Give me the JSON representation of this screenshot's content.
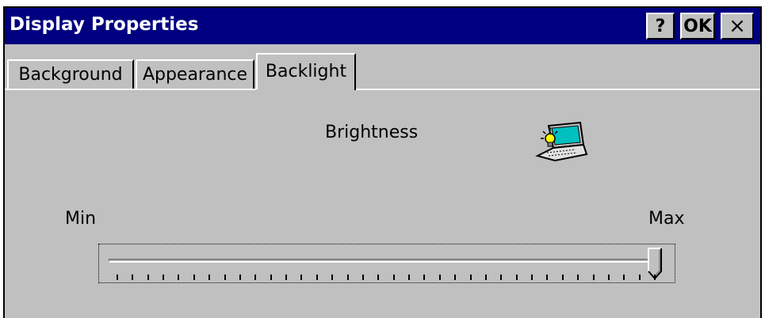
{
  "window": {
    "title": "Display Properties",
    "help_label": "?",
    "ok_label": "OK",
    "close_label": "×"
  },
  "tabs": [
    {
      "label": "Background",
      "active": false
    },
    {
      "label": "Appearance",
      "active": false
    },
    {
      "label": "Backlight",
      "active": true
    }
  ],
  "backlight": {
    "heading": "Brightness",
    "icon": "laptop-backlight-icon",
    "slider": {
      "min_label": "Min",
      "max_label": "Max",
      "value_fraction": 1.0,
      "tick_count": 36
    }
  },
  "colors": {
    "titlebar": "#000080",
    "face": "#c0c0c0"
  }
}
